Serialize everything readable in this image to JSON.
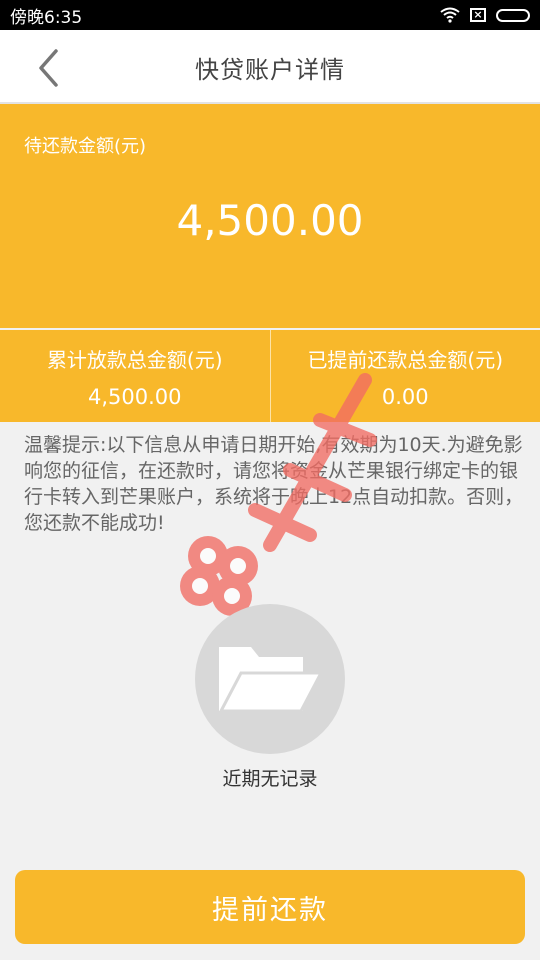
{
  "status_bar": {
    "time": "傍晚6:35"
  },
  "header": {
    "title": "快贷账户详情"
  },
  "summary": {
    "label": "待还款金额(元)",
    "amount": "4,500.00"
  },
  "stats": [
    {
      "label": "累计放款总金额(元)",
      "value": "4,500.00"
    },
    {
      "label": "已提前还款总金额(元)",
      "value": "0.00"
    }
  ],
  "notice": "温馨提示:以下信息从申请日期开始,有效期为10天.为避免影响您的征信，在还款时，请您将资金从芒果银行绑定卡的银行卡转入到芒果账户，系统将于晚上12点自动扣款。否则，您还款不能成功!",
  "empty_state": {
    "text": "近期无记录"
  },
  "actions": {
    "prepay_label": "提前还款"
  },
  "colors": {
    "accent": "#f8b82b",
    "background": "#f1f1f1",
    "watermark": "#f26c63"
  },
  "icons": {
    "back": "chevron-left-icon",
    "empty": "folder-icon",
    "wifi": "wifi-icon",
    "battery": "battery-icon"
  }
}
